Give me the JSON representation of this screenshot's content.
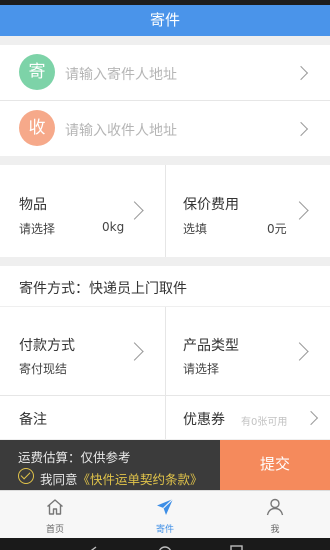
{
  "header": {
    "title": "寄件"
  },
  "sender": {
    "badge": "寄",
    "placeholder": "请输入寄件人地址",
    "badge_color": "#7dd3a8"
  },
  "receiver": {
    "badge": "收",
    "placeholder": "请输入收件人地址",
    "badge_color": "#f6a98a"
  },
  "goods": {
    "label": "物品",
    "value": "请选择",
    "weight": "0kg"
  },
  "insurance": {
    "label": "保价费用",
    "value": "选填",
    "amount": "0元"
  },
  "method": {
    "label": "寄件方式：快递员上门取件"
  },
  "payment": {
    "label": "付款方式",
    "value": "寄付现结"
  },
  "product": {
    "label": "产品类型",
    "value": "请选择"
  },
  "remark": {
    "label": "备注"
  },
  "coupon": {
    "label": "优惠券",
    "hint": "有0张可用"
  },
  "footer": {
    "estimate": "运费估算：仅供参考",
    "agree_prefix": "我同意",
    "agree_link": "《快件运单契约条款》",
    "submit": "提交"
  },
  "tabs": [
    {
      "label": "首页",
      "icon": "home-icon"
    },
    {
      "label": "寄件",
      "icon": "send-icon"
    },
    {
      "label": "我",
      "icon": "person-icon"
    }
  ],
  "colors": {
    "primary": "#4a94ea",
    "submit": "#f58a5c",
    "agree": "#e0c34a",
    "active_tab": "#3d8ee6"
  }
}
